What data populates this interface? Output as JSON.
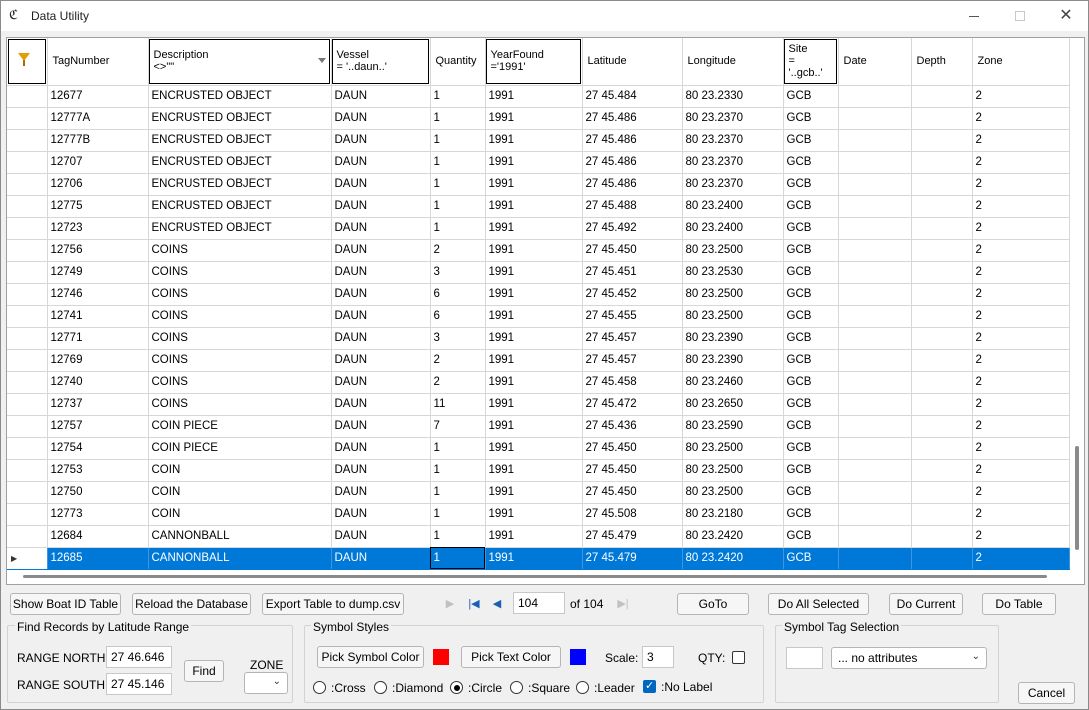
{
  "window": {
    "title": "Data Utility",
    "app_icon": "cp-logo-icon"
  },
  "grid": {
    "columns": [
      {
        "label": "",
        "name": "filter-column"
      },
      {
        "label": "TagNumber"
      },
      {
        "label": "Description",
        "filter": "<>\"\""
      },
      {
        "label": "Vessel",
        "filter": "= '..daun..'"
      },
      {
        "label": "Quantity"
      },
      {
        "label": "YearFound",
        "filter": "='1991'"
      },
      {
        "label": "Latitude"
      },
      {
        "label": "Longitude"
      },
      {
        "label": "Site",
        "filter": "=\n'..gcb..'"
      },
      {
        "label": "Date"
      },
      {
        "label": "Depth"
      },
      {
        "label": "Zone"
      }
    ],
    "rows": [
      [
        "12677",
        "ENCRUSTED OBJECT",
        "DAUN",
        "1",
        "1991",
        "27 45.484",
        "80 23.2330",
        "GCB",
        "",
        "",
        "2"
      ],
      [
        "12777A",
        "ENCRUSTED OBJECT",
        "DAUN",
        "1",
        "1991",
        "27 45.486",
        "80 23.2370",
        "GCB",
        "",
        "",
        "2"
      ],
      [
        "12777B",
        "ENCRUSTED OBJECT",
        "DAUN",
        "1",
        "1991",
        "27 45.486",
        "80 23.2370",
        "GCB",
        "",
        "",
        "2"
      ],
      [
        "12707",
        "ENCRUSTED OBJECT",
        "DAUN",
        "1",
        "1991",
        "27 45.486",
        "80 23.2370",
        "GCB",
        "",
        "",
        "2"
      ],
      [
        "12706",
        "ENCRUSTED OBJECT",
        "DAUN",
        "1",
        "1991",
        "27 45.486",
        "80 23.2370",
        "GCB",
        "",
        "",
        "2"
      ],
      [
        "12775",
        "ENCRUSTED OBJECT",
        "DAUN",
        "1",
        "1991",
        "27 45.488",
        "80 23.2400",
        "GCB",
        "",
        "",
        "2"
      ],
      [
        "12723",
        "ENCRUSTED OBJECT",
        "DAUN",
        "1",
        "1991",
        "27 45.492",
        "80 23.2400",
        "GCB",
        "",
        "",
        "2"
      ],
      [
        "12756",
        "COINS",
        "DAUN",
        "2",
        "1991",
        "27 45.450",
        "80 23.2500",
        "GCB",
        "",
        "",
        "2"
      ],
      [
        "12749",
        "COINS",
        "DAUN",
        "3",
        "1991",
        "27 45.451",
        "80 23.2530",
        "GCB",
        "",
        "",
        "2"
      ],
      [
        "12746",
        "COINS",
        "DAUN",
        "6",
        "1991",
        "27 45.452",
        "80 23.2500",
        "GCB",
        "",
        "",
        "2"
      ],
      [
        "12741",
        "COINS",
        "DAUN",
        "6",
        "1991",
        "27 45.455",
        "80 23.2500",
        "GCB",
        "",
        "",
        "2"
      ],
      [
        "12771",
        "COINS",
        "DAUN",
        "3",
        "1991",
        "27 45.457",
        "80 23.2390",
        "GCB",
        "",
        "",
        "2"
      ],
      [
        "12769",
        "COINS",
        "DAUN",
        "2",
        "1991",
        "27 45.457",
        "80 23.2390",
        "GCB",
        "",
        "",
        "2"
      ],
      [
        "12740",
        "COINS",
        "DAUN",
        "2",
        "1991",
        "27 45.458",
        "80 23.2460",
        "GCB",
        "",
        "",
        "2"
      ],
      [
        "12737",
        "COINS",
        "DAUN",
        "11",
        "1991",
        "27 45.472",
        "80 23.2650",
        "GCB",
        "",
        "",
        "2"
      ],
      [
        "12757",
        "COIN PIECE",
        "DAUN",
        "7",
        "1991",
        "27 45.436",
        "80 23.2590",
        "GCB",
        "",
        "",
        "2"
      ],
      [
        "12754",
        "COIN PIECE",
        "DAUN",
        "1",
        "1991",
        "27 45.450",
        "80 23.2500",
        "GCB",
        "",
        "",
        "2"
      ],
      [
        "12753",
        "COIN",
        "DAUN",
        "1",
        "1991",
        "27 45.450",
        "80 23.2500",
        "GCB",
        "",
        "",
        "2"
      ],
      [
        "12750",
        "COIN",
        "DAUN",
        "1",
        "1991",
        "27 45.450",
        "80 23.2500",
        "GCB",
        "",
        "",
        "2"
      ],
      [
        "12773",
        "COIN",
        "DAUN",
        "1",
        "1991",
        "27 45.508",
        "80 23.2180",
        "GCB",
        "",
        "",
        "2"
      ],
      [
        "12684",
        "CANNONBALL",
        "DAUN",
        "1",
        "1991",
        "27 45.479",
        "80 23.2420",
        "GCB",
        "",
        "",
        "2"
      ],
      [
        "12685",
        "CANNONBALL",
        "DAUN",
        "1",
        "1991",
        "27 45.479",
        "80 23.2420",
        "GCB",
        "",
        "",
        "2"
      ]
    ],
    "selected_row_index": 21,
    "selection_color": "#0078d7"
  },
  "toolbar": {
    "show_boat": "Show Boat ID Table",
    "reload": "Reload the Database",
    "export": "Export Table to dump.csv",
    "page_value": "104",
    "page_of": "of 104",
    "goto": "GoTo",
    "do_all_selected": "Do All Selected",
    "do_current": "Do Current",
    "do_table": "Do Table"
  },
  "find": {
    "title": "Find Records by Latitude Range",
    "north_label": "RANGE NORTH:",
    "north_value": "27 46.646",
    "south_label": "RANGE SOUTH:",
    "south_value": "27 45.146",
    "find_btn": "Find",
    "zone_label": "ZONE",
    "zone_value": ""
  },
  "symbol": {
    "title": "Symbol Styles",
    "pick_symbol": "Pick Symbol Color",
    "symbol_color": "#ff0000",
    "pick_text": "Pick Text Color",
    "text_color": "#0000ff",
    "scale_label": "Scale:",
    "scale_value": "3",
    "qty_label": "QTY:",
    "qty_checked": false,
    "shapes": [
      {
        "label": ":Cross",
        "checked": false
      },
      {
        "label": ":Diamond",
        "checked": false
      },
      {
        "label": ":Circle",
        "checked": true
      },
      {
        "label": ":Square",
        "checked": false
      },
      {
        "label": ":Leader",
        "checked": false
      }
    ],
    "no_label": ":No Label",
    "no_label_checked": true
  },
  "tag": {
    "title": "Symbol Tag Selection",
    "input_value": "",
    "dropdown_value": "... no attributes"
  },
  "cancel": "Cancel"
}
